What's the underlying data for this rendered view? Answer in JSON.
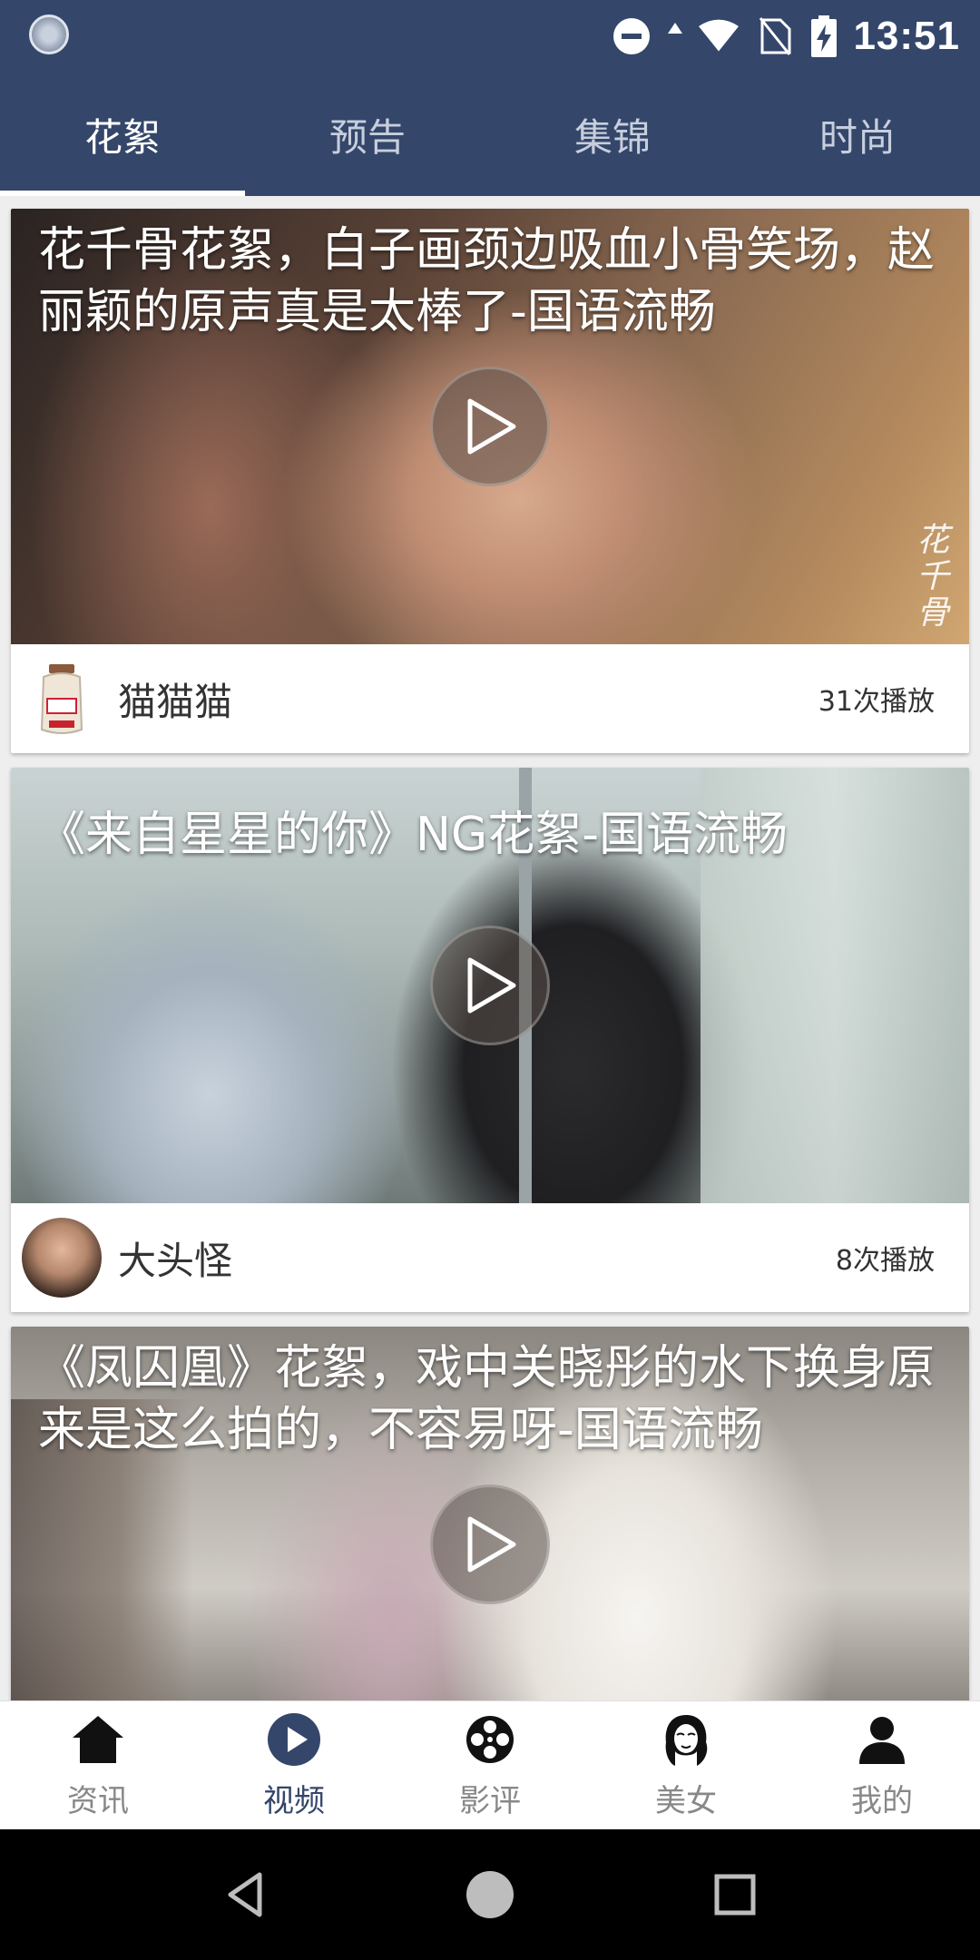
{
  "status_bar": {
    "time": "13:51",
    "icons": [
      "loading-icon",
      "do-not-disturb-icon",
      "data-arrows-icon",
      "wifi-icon",
      "no-sim-icon",
      "battery-charging-icon"
    ]
  },
  "top_tabs": [
    {
      "label": "花絮",
      "active": true
    },
    {
      "label": "预告",
      "active": false
    },
    {
      "label": "集锦",
      "active": false
    },
    {
      "label": "时尚",
      "active": false
    }
  ],
  "feed": [
    {
      "title": "花千骨花絮，白子画颈边吸血小骨笑场，赵丽颖的原声真是太棒了-国语流畅",
      "author": "猫猫猫",
      "plays": "31次播放",
      "watermark": "花千骨"
    },
    {
      "title": "《来自星星的你》NG花絮-国语流畅",
      "author": "大头怪",
      "plays": "8次播放"
    },
    {
      "title": "《凤囚凰》花絮，戏中关晓彤的水下换身原来是这么拍的，不容易呀-国语流畅"
    }
  ],
  "bottom_nav": [
    {
      "label": "资讯",
      "icon": "home-icon",
      "active": false
    },
    {
      "label": "视频",
      "icon": "play-circle-icon",
      "active": true
    },
    {
      "label": "影评",
      "icon": "film-reel-icon",
      "active": false
    },
    {
      "label": "美女",
      "icon": "woman-face-icon",
      "active": false
    },
    {
      "label": "我的",
      "icon": "person-icon",
      "active": false
    }
  ],
  "colors": {
    "primary": "#34466a",
    "inactive": "#888888",
    "background": "#eeeeee"
  }
}
